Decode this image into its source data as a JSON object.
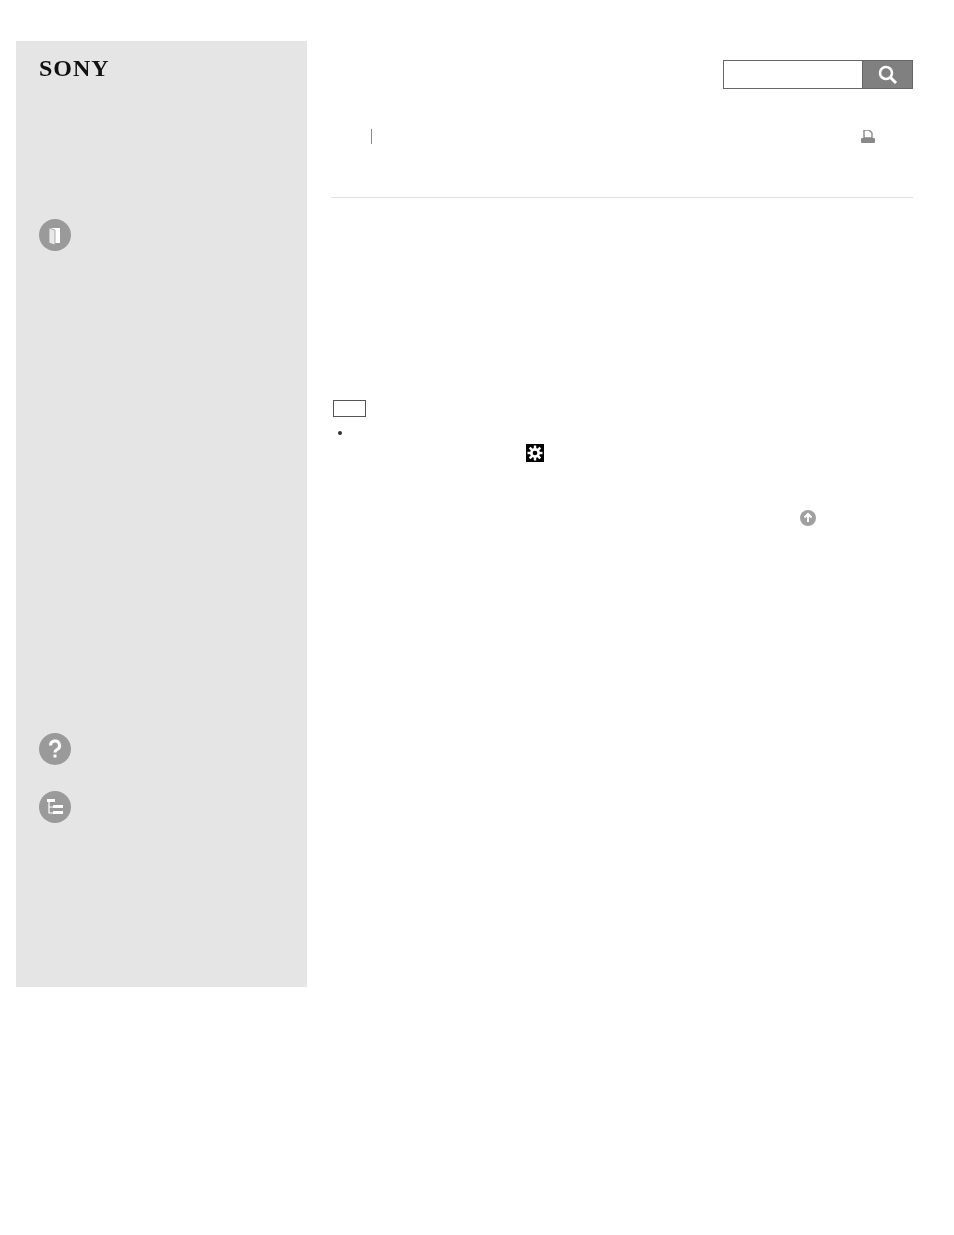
{
  "logo": "SONY"
}
